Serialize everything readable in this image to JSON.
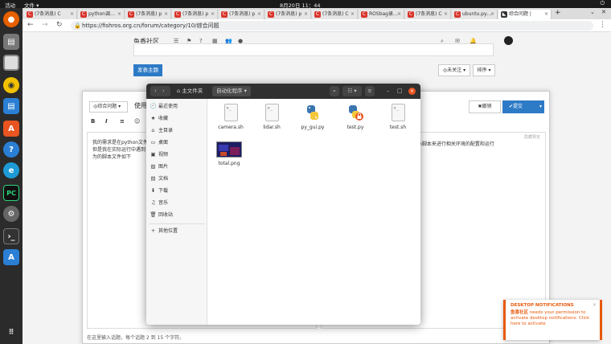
{
  "topbar": {
    "activities": "活动",
    "app_menu": "文件 ▾",
    "clock": "8月20日  11：44",
    "system_icons": "⏻"
  },
  "browser": {
    "tabs": [
      {
        "label": "(7条消息) C",
        "active": false
      },
      {
        "label": "python调…",
        "active": false
      },
      {
        "label": "(7条消息) p",
        "active": false
      },
      {
        "label": "(7条消息) p",
        "active": false
      },
      {
        "label": "(7条消息) p",
        "active": false
      },
      {
        "label": "(7条消息) p",
        "active": false
      },
      {
        "label": "(7条消息) C",
        "active": false
      },
      {
        "label": "ROSbag录…",
        "active": false
      },
      {
        "label": "(7条消息) C",
        "active": false
      },
      {
        "label": "ubuntu.py…",
        "active": false
      },
      {
        "label": "综合问题 |",
        "active": true
      }
    ],
    "new_tab": "+",
    "url": "https://fishros.org.cn/forum/category/10/综合问题"
  },
  "forum": {
    "site_title": "鱼香社区",
    "post_button": "发表主题",
    "unwatched_button": "◎未关注 ▾",
    "sort_button": "排序 ▾"
  },
  "composer": {
    "category": "◎综合问题 ▾",
    "title_value": "使用",
    "cancel": "✖撤销",
    "submit": "✔提交",
    "toolbar": [
      "B",
      "I",
      "≡",
      "☺"
    ],
    "editor_lines": [
      "我的需求是在python文件",
      "但是我在实际运行中遇到",
      "为的脚本文件如下"
    ],
    "preview_label": "隐藏预览",
    "preview_text": ".sh脚本来进行相关环境的配置和运行",
    "hint": "在这里输入话题，每个话题 2 到 15 个字符。"
  },
  "dialog": {
    "path_home": "主文件夹",
    "path_current": "自动化程序",
    "sidebar": [
      {
        "icon": "🕘",
        "label": "最近使用"
      },
      {
        "icon": "★",
        "label": "收藏"
      },
      {
        "icon": "⌂",
        "label": "主目录"
      },
      {
        "icon": "▭",
        "label": "桌面"
      },
      {
        "icon": "▣",
        "label": "视频"
      },
      {
        "icon": "▨",
        "label": "图片"
      },
      {
        "icon": "▤",
        "label": "文档"
      },
      {
        "icon": "⬇",
        "label": "下载"
      },
      {
        "icon": "♫",
        "label": "音乐"
      },
      {
        "icon": "🗑",
        "label": "回收站"
      }
    ],
    "other_locations": "其他位置",
    "files": [
      {
        "name": "camera.sh",
        "type": "sh"
      },
      {
        "name": "lidar.sh",
        "type": "sh"
      },
      {
        "name": "py_gui.py",
        "type": "py"
      },
      {
        "name": "test.py",
        "type": "py-locked"
      },
      {
        "name": "test.sh",
        "type": "sh"
      },
      {
        "name": "total.png",
        "type": "png"
      }
    ]
  },
  "notification": {
    "title": "DESKTOP NOTIFICATIONS",
    "body_brand": "鱼香社区",
    "body": " needs your permission to activate desktop notifications. Click here to activate"
  },
  "colors": {
    "accent": "#2d7ac6",
    "ubuntu_orange": "#e95420",
    "notify_orange": "#e8590c"
  }
}
